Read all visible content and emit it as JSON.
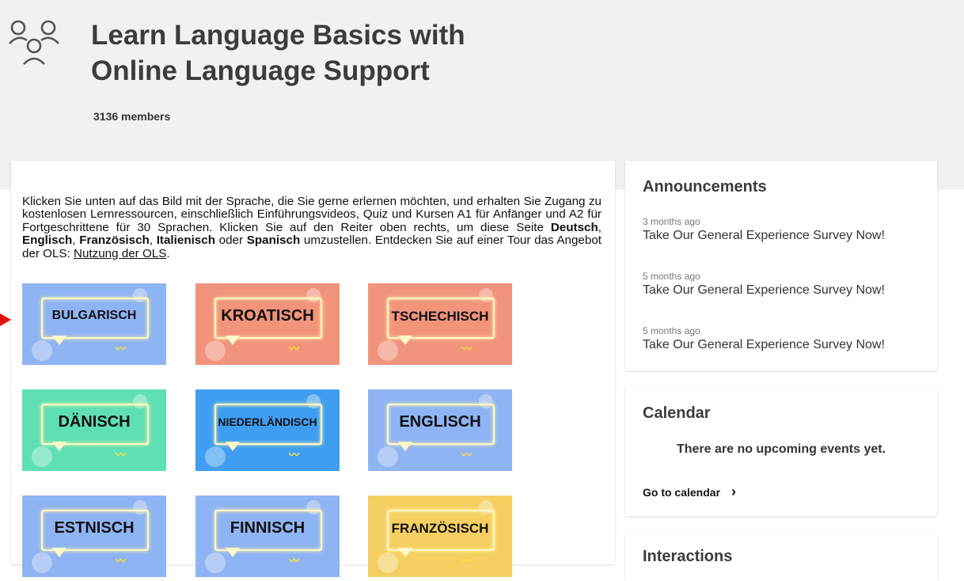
{
  "group": {
    "title_line1": "Learn Language Basics with",
    "title_line2": "Online Language Support",
    "members": "3136 members",
    "icon": "group-icon"
  },
  "intro": {
    "part1": "Klicken Sie unten auf das Bild mit der Sprache, die Sie gerne erlernen möchten, und erhalten Sie Zugang zu kostenlosen Lernressourcen, einschließlich Einführungsvideos, Quiz und Kursen A1 für Anfänger und A2 für Fortgeschrittene für 30 Sprachen. Klicken Sie auf den Reiter oben rechts, um diese Seite ",
    "lang_de": "Deutsch",
    "sep1": ", ",
    "lang_en": "Englisch",
    "sep2": ", ",
    "lang_fr": "Französisch",
    "sep3": ", ",
    "lang_it": "Italienisch",
    "or": " oder ",
    "lang_es": "Spanisch",
    "part2": " umzustellen. Entdecken Sie auf einer Tour das Angebot der OLS: ",
    "link": "Nutzung der OLS",
    "end": "."
  },
  "languages": [
    {
      "label": "BULGARISCH",
      "bg": "#8fb4f3"
    },
    {
      "label": "KROATISCH",
      "bg": "#f2937c"
    },
    {
      "label": "TSCHECHISCH",
      "bg": "#f2937c"
    },
    {
      "label": "DÄNISCH",
      "bg": "#5fe0b4"
    },
    {
      "label": "NIEDERLÄNDISCH",
      "bg": "#3f9ef2"
    },
    {
      "label": "ENGLISCH",
      "bg": "#8fb4f3"
    },
    {
      "label": "ESTNISCH",
      "bg": "#8fb4f3"
    },
    {
      "label": "FINNISCH",
      "bg": "#8fb4f3"
    },
    {
      "label": "FRANZÖSISCH",
      "bg": "#f5cf62"
    }
  ],
  "announcements": {
    "title": "Announcements",
    "items": [
      {
        "time": "3 months ago",
        "text": "Take Our General Experience Survey Now!"
      },
      {
        "time": "5 months ago",
        "text": "Take Our General Experience Survey Now!"
      },
      {
        "time": "5 months ago",
        "text": "Take Our General Experience Survey Now!"
      }
    ]
  },
  "calendar": {
    "title": "Calendar",
    "empty": "There are no upcoming events yet.",
    "link": "Go to calendar",
    "chevron": "›"
  },
  "interactions": {
    "title": "Interactions"
  },
  "colors": {
    "header_bg": "#f1f1f1",
    "arrow": "#e3120b"
  }
}
